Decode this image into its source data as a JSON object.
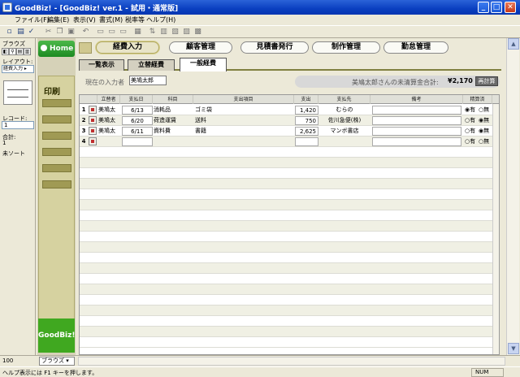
{
  "window": {
    "title": "GoodBiz! - [GoodBiz! ver.1 - 試用・通常版]",
    "minimize": "_",
    "maximize": "□",
    "close": "✕"
  },
  "menu": [
    "ファイル(F)",
    "編集(E)",
    "表示(V)",
    "書式(M)",
    "税率等",
    "ヘルプ(H)"
  ],
  "left_pane": {
    "browse_label": "ブラウズ",
    "layout_label": "レイアウト:",
    "layout_value": "経費入力",
    "record_label": "レコード:",
    "record_value": "1",
    "total_label": "合計:",
    "total_value": "1",
    "sort_label": "未ソート"
  },
  "nav": {
    "home_label": "Home",
    "print_label": "印刷",
    "brand": "GoodBiz!"
  },
  "top_tabs": [
    "経費入力",
    "顧客管理",
    "見積書発行",
    "制作管理",
    "勤怠管理"
  ],
  "active_top_tab": "経費入力",
  "sub_tabs": [
    "一覧表示",
    "立替経費",
    "一般経費"
  ],
  "active_sub_tab": "一般経費",
  "inputter": {
    "label": "現在の入力者",
    "value": "美鳩太郎"
  },
  "unsettled": {
    "label": "美鳩太郎さんの未清算金合計:",
    "amount": "¥2,170",
    "recalc_label": "再計算"
  },
  "columns": [
    "立替者",
    "支払日",
    "科目",
    "支出項目",
    "支出",
    "支払先",
    "備考",
    "精算済"
  ],
  "rows": [
    {
      "no": "1",
      "payer": "美鳩太",
      "date": "6/13",
      "account": "消耗品",
      "item": "ゴミ袋",
      "amount": "1,420",
      "payee": "むらの",
      "note": "",
      "yes": "有",
      "no_label": "無",
      "settled": "yes"
    },
    {
      "no": "2",
      "payer": "美鳩太",
      "date": "6/20",
      "account": "荷造運賃",
      "item": "送料",
      "amount": "750",
      "payee": "佐川急便(株)",
      "note": "",
      "yes": "有",
      "no_label": "無",
      "settled": "no"
    },
    {
      "no": "3",
      "payer": "美鳩太",
      "date": "6/11",
      "account": "資料費",
      "item": "書籍",
      "amount": "2,625",
      "payee": "マンボ書店",
      "note": "",
      "yes": "有",
      "no_label": "無",
      "settled": "no"
    },
    {
      "no": "4",
      "payer": "",
      "date": "",
      "account": "",
      "item": "",
      "amount": "",
      "payee": "",
      "note": "",
      "yes": "有",
      "no_label": "無",
      "settled": "none"
    }
  ],
  "bottom": {
    "zoom": "100",
    "mode": "ブラウズ"
  },
  "status": {
    "text": "ヘルプ表示には F1 キーを押します。",
    "num": "NUM"
  },
  "colors": {
    "titlebar": "#0a3fc0",
    "home": "#1d8a22",
    "brand": "#40a820",
    "print_panel": "#d6d2a0"
  }
}
